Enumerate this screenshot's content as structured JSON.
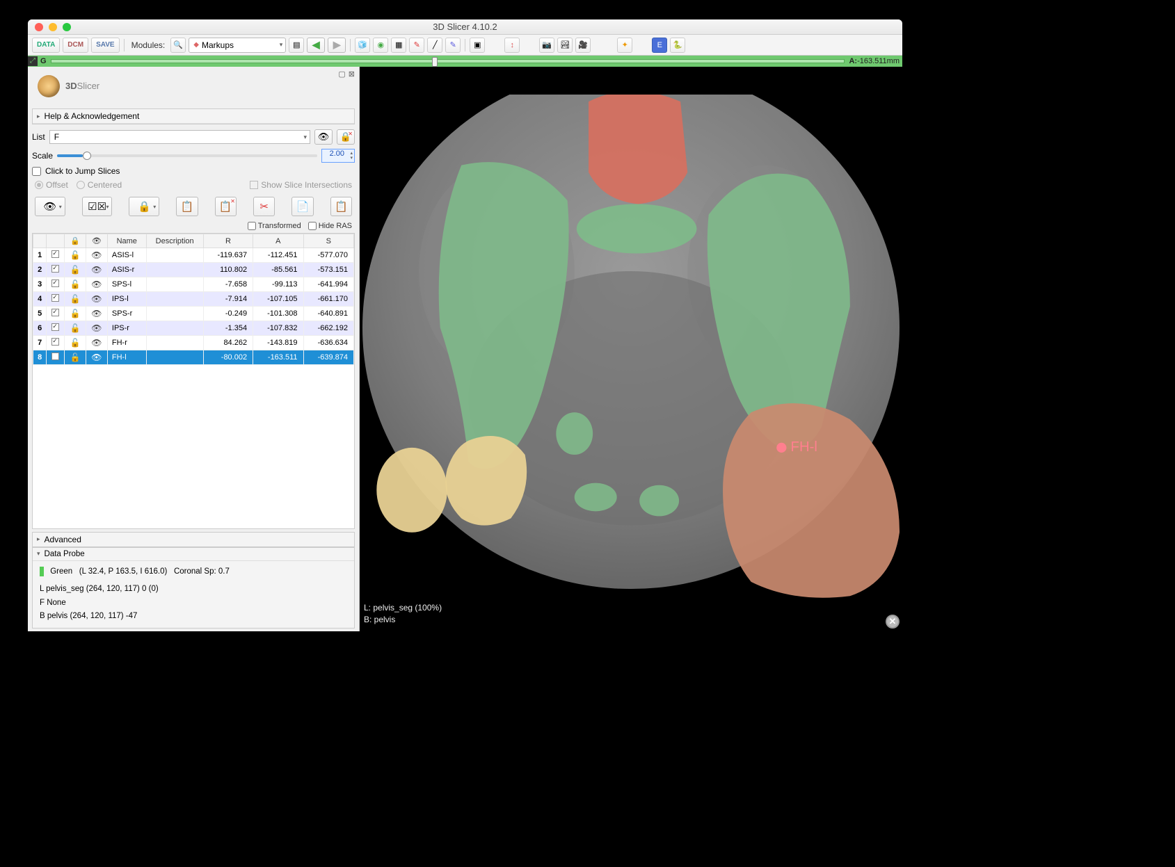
{
  "window": {
    "title": "3D Slicer 4.10.2"
  },
  "toolbar": {
    "data_btn": "DATA",
    "dcm_btn": "DCM",
    "save_btn": "SAVE",
    "modules_label": "Modules:",
    "module_selected": "Markups"
  },
  "slice_bar": {
    "g": "G",
    "a": "A:",
    "position": "-163.511mm"
  },
  "panel": {
    "brand_3d": "3D",
    "brand_slicer": "Slicer",
    "help_header": "Help & Acknowledgement",
    "list_label": "List",
    "list_value": "F",
    "scale_label": "Scale",
    "scale_value": "2.00",
    "click_jump": "Click to Jump Slices",
    "offset": "Offset",
    "centered": "Centered",
    "show_intersections": "Show Slice Intersections",
    "transformed": "Transformed",
    "hide_ras": "Hide RAS",
    "advanced": "Advanced",
    "dataprobe": "Data Probe"
  },
  "table": {
    "headers": {
      "name": "Name",
      "description": "Description",
      "r": "R",
      "a": "A",
      "s": "S"
    },
    "rows": [
      {
        "idx": "1",
        "checked": true,
        "name": "ASIS-l",
        "desc": "",
        "r": "-119.637",
        "a": "-112.451",
        "s": "-577.070",
        "even": false,
        "sel": false
      },
      {
        "idx": "2",
        "checked": true,
        "name": "ASIS-r",
        "desc": "",
        "r": "110.802",
        "a": "-85.561",
        "s": "-573.151",
        "even": true,
        "sel": false
      },
      {
        "idx": "3",
        "checked": true,
        "name": "SPS-l",
        "desc": "",
        "r": "-7.658",
        "a": "-99.113",
        "s": "-641.994",
        "even": false,
        "sel": false
      },
      {
        "idx": "4",
        "checked": true,
        "name": "IPS-l",
        "desc": "",
        "r": "-7.914",
        "a": "-107.105",
        "s": "-661.170",
        "even": true,
        "sel": false
      },
      {
        "idx": "5",
        "checked": true,
        "name": "SPS-r",
        "desc": "",
        "r": "-0.249",
        "a": "-101.308",
        "s": "-640.891",
        "even": false,
        "sel": false
      },
      {
        "idx": "6",
        "checked": true,
        "name": "IPS-r",
        "desc": "",
        "r": "-1.354",
        "a": "-107.832",
        "s": "-662.192",
        "even": true,
        "sel": false
      },
      {
        "idx": "7",
        "checked": true,
        "name": "FH-r",
        "desc": "",
        "r": "84.262",
        "a": "-143.819",
        "s": "-636.634",
        "even": false,
        "sel": false
      },
      {
        "idx": "8",
        "checked": true,
        "name": "FH-l",
        "desc": "",
        "r": "-80.002",
        "a": "-163.511",
        "s": "-639.874",
        "even": true,
        "sel": true
      }
    ]
  },
  "dataprobe": {
    "green_label": "Green",
    "coords": "(L 32.4, P 163.5, I 616.0)",
    "spacing": "Coronal Sp: 0.7",
    "L": "L pelvis_seg (264, 120, 117) 0 (0)",
    "F": "F None",
    "B": "B pelvis       (264, 120, 117) -47"
  },
  "viewer": {
    "marker_label": "FH-l",
    "overlay_L": "L: pelvis_seg (100%)",
    "overlay_B": "B: pelvis"
  },
  "colors": {
    "seg_green": "#7fb98a",
    "seg_tan": "#e8d193",
    "seg_salmon": "#c98a6f",
    "seg_red": "#d86f5e",
    "marker": "#ff7f8e"
  }
}
